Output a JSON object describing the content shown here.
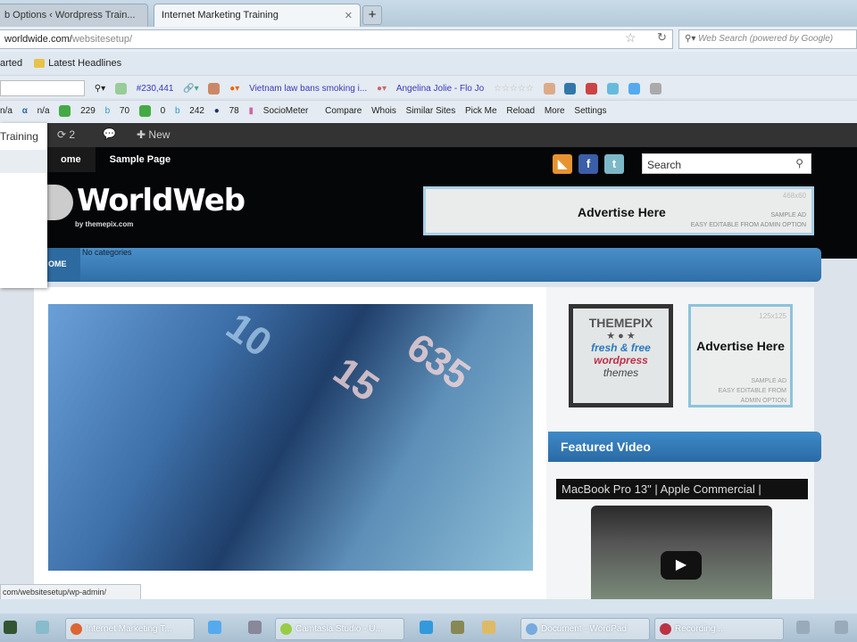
{
  "browser": {
    "tabs": [
      {
        "label": "b Options ‹ Wordpress Train..."
      },
      {
        "label": "Internet Marketing Training"
      }
    ],
    "new_tab": "+",
    "url_host": "worldwide.com/",
    "url_path": "websitesetup/",
    "search_placeholder": "Web Search (powered by Google)",
    "bookmarks": [
      "arted",
      "Latest Headlines"
    ],
    "toolbar1": {
      "rank": "#230,441",
      "news": "Vietnam law bans smoking i...",
      "celeb": "Angelina Jolie - Flo Jo"
    },
    "toolbar2": {
      "na1": "n/a",
      "na2": "n/a",
      "v1": "229",
      "v2": "70",
      "v3": "0",
      "v4": "242",
      "v5": "78",
      "sociometer": "SocioMeter",
      "compare": "Compare",
      "whois": "Whois",
      "similar": "Similar Sites",
      "pickme": "Pick Me",
      "reload": "Reload",
      "more": "More",
      "settings": "Settings"
    },
    "status_url": "com/websitesetup/wp-admin/"
  },
  "adminbar": {
    "site": "Training",
    "updates": "2",
    "new": "New"
  },
  "site": {
    "nav": [
      "ome",
      "Sample Page"
    ],
    "logo": "WorldWeb",
    "byline": "by themepix.com",
    "search_placeholder": "Search",
    "banner": {
      "size": "468x60",
      "title": "Advertise Here",
      "sample": "SAMPLE AD",
      "easy": "EASY EDITABLE FROM ADMIN OPTION"
    },
    "catbar": {
      "home": "OME",
      "nocat": "No categories"
    },
    "hero_numbers": [
      "15",
      "635",
      "10"
    ],
    "themepix": {
      "t1": "THEMEPIX",
      "t2": "fresh & free",
      "t3": "wordpress",
      "t4": "themes"
    },
    "ad125": {
      "size": "125x125",
      "title": "Advertise Here",
      "sample": "SAMPLE AD",
      "easy": "EASY EDITABLE FROM ADMIN OPTION"
    },
    "featured": "Featured Video",
    "video_title": "MacBook Pro 13\" | Apple Commercial |"
  },
  "taskbar": [
    {
      "label": "Internet Marketing T..."
    },
    {
      "label": "Camtasia Studio - U..."
    },
    {
      "label": "Document - WordPad"
    },
    {
      "label": "Recording..."
    }
  ]
}
